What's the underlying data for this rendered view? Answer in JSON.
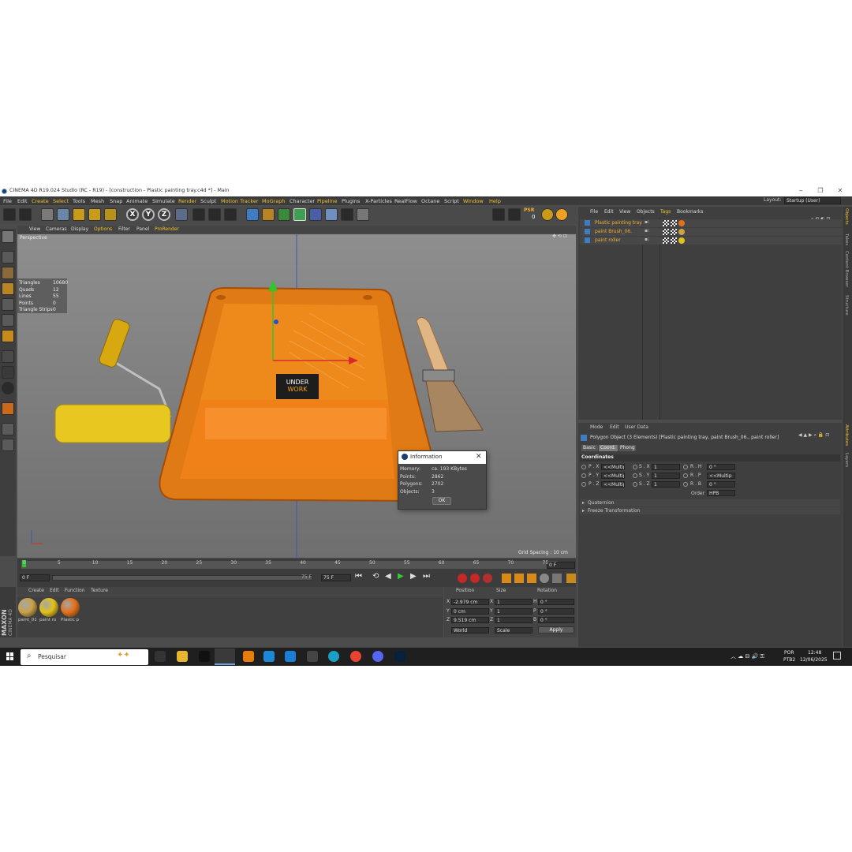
{
  "window": {
    "title": "CINEMA 4D R19.024 Studio (RC - R19) - [construction - Plastic painting tray.c4d *] - Main",
    "controls": [
      "‒",
      "❐",
      "✕"
    ]
  },
  "menubar": {
    "items": [
      {
        "label": "File",
        "hl": false
      },
      {
        "label": "Edit",
        "hl": false
      },
      {
        "label": "Create",
        "hl": true
      },
      {
        "label": "Select",
        "hl": true
      },
      {
        "label": "Tools",
        "hl": false
      },
      {
        "label": "Mesh",
        "hl": false
      },
      {
        "label": "Snap",
        "hl": false
      },
      {
        "label": "Animate",
        "hl": false
      },
      {
        "label": "Simulate",
        "hl": false
      },
      {
        "label": "Render",
        "hl": true
      },
      {
        "label": "Sculpt",
        "hl": false
      },
      {
        "label": "Motion Tracker",
        "hl": true
      },
      {
        "label": "MoGraph",
        "hl": true
      },
      {
        "label": "Character",
        "hl": false
      },
      {
        "label": "Pipeline",
        "hl": true
      },
      {
        "label": "Plugins",
        "hl": false
      },
      {
        "label": "X-Particles",
        "hl": false
      },
      {
        "label": "RealFlow",
        "hl": false
      },
      {
        "label": "Octane",
        "hl": false
      },
      {
        "label": "Script",
        "hl": false
      },
      {
        "label": "Window",
        "hl": true
      },
      {
        "label": "Help",
        "hl": true
      }
    ],
    "layout_label": "Layout:",
    "layout_value": "Startup (User)"
  },
  "toolbar": {
    "axes": [
      "X",
      "Y",
      "Z"
    ],
    "psr_label": "PSR",
    "psr_value": "0"
  },
  "viewport": {
    "menu": [
      "View",
      "Cameras",
      "Display",
      "Options",
      "Filter",
      "Panel",
      "ProRender"
    ],
    "name": "Perspective",
    "stats": [
      [
        "Triangles",
        "10680"
      ],
      [
        "Quads",
        "12"
      ],
      [
        "Lines",
        "55"
      ],
      [
        "Points",
        "0"
      ],
      [
        "Triangle Strips",
        "0"
      ]
    ],
    "grid_spacing": "Grid Spacing : 10 cm",
    "logo_text": [
      "UNDER",
      "WORK"
    ]
  },
  "dialog": {
    "title": "Information",
    "rows": [
      [
        "Memory:",
        "ca. 193 KBytes"
      ],
      [
        "Points:",
        "2862"
      ],
      [
        "Polygons:",
        "2702"
      ],
      [
        "Objects:",
        "3"
      ]
    ],
    "ok": "OK"
  },
  "timeline": {
    "ticks": [
      "0",
      "5",
      "10",
      "15",
      "20",
      "25",
      "30",
      "35",
      "40",
      "45",
      "50",
      "55",
      "60",
      "65",
      "70",
      "75"
    ],
    "current_frame": "0 F",
    "start": "0 F",
    "end": "75 F",
    "end2": "75 F",
    "frame_field": "0 F"
  },
  "materials": {
    "menu": [
      "Create",
      "Edit",
      "Function",
      "Texture"
    ],
    "items": [
      {
        "label": "paint_01",
        "color": "#c9a24a"
      },
      {
        "label": "paint ro",
        "color": "#e2c21a"
      },
      {
        "label": "Plastic p",
        "color": "#e5701a"
      }
    ]
  },
  "coords": {
    "headers": [
      "Position",
      "Size",
      "Rotation"
    ],
    "rows": [
      {
        "axis": "X",
        "pos": "-2.979 cm",
        "size": "1",
        "rlabel": "H",
        "rot": "0 °"
      },
      {
        "axis": "Y",
        "pos": "0 cm",
        "size": "1",
        "rlabel": "P",
        "rot": "0 °"
      },
      {
        "axis": "Z",
        "pos": "9.519 cm",
        "size": "1",
        "rlabel": "B",
        "rot": "0 °"
      }
    ],
    "space": "World",
    "mode": "Scale",
    "apply": "Apply"
  },
  "objects": {
    "menu": [
      "File",
      "Edit",
      "View",
      "Objects",
      "Tags",
      "Bookmarks"
    ],
    "items": [
      "Plastic painting tray",
      "paint Brush_06.",
      "paint roller"
    ]
  },
  "attributes": {
    "menu": [
      "Mode",
      "Edit",
      "User Data"
    ],
    "heading": "Polygon Object (3 Elements) [Plastic painting tray, paint Brush_06., paint roller]",
    "tabs": [
      "Basic",
      "Coord.",
      "Phong"
    ],
    "section": "Coordinates",
    "rows": [
      {
        "p": "P . X",
        "pv": "<<Multip",
        "s": "S . X",
        "sv": "1",
        "r": "R . H",
        "rv": "0 °"
      },
      {
        "p": "P . Y",
        "pv": "<<Multip",
        "s": "S . Y",
        "sv": "1",
        "r": "R . P",
        "rv": "<<Multip"
      },
      {
        "p": "P . Z",
        "pv": "<<Multip",
        "s": "S . Z",
        "sv": "1",
        "r": "R . B",
        "rv": "0 °"
      }
    ],
    "order_label": "Order",
    "order_value": "HPB",
    "groups": [
      "Quaternion",
      "Freeze Transformation"
    ]
  },
  "side_tabs": [
    "Objects",
    "Takes",
    "Content Browser",
    "Structure",
    "Attributes",
    "Layers"
  ],
  "maxon": [
    "MAXON",
    "CINEMA 4D"
  ],
  "taskbar": {
    "search": "Pesquisar",
    "lang": [
      "POR",
      "PTB2"
    ],
    "time": "12:48",
    "date": "12/06/2025",
    "apps": [
      {
        "name": "task-view",
        "color": "#333"
      },
      {
        "name": "file-explorer",
        "color": "#e8b532"
      },
      {
        "name": "x-app",
        "color": "#111"
      },
      {
        "name": "cinema4d",
        "color": "#2a4a8a"
      },
      {
        "name": "blender",
        "color": "#e87d0d"
      },
      {
        "name": "app-blue",
        "color": "#1e88d8"
      },
      {
        "name": "vscode",
        "color": "#1a7fd4"
      },
      {
        "name": "calculator",
        "color": "#444"
      },
      {
        "name": "edge",
        "color": "#1aa0c8"
      },
      {
        "name": "chrome",
        "color": "#e94235"
      },
      {
        "name": "discord",
        "color": "#5865f2"
      },
      {
        "name": "photoshop",
        "color": "#0a1f3c"
      }
    ]
  }
}
